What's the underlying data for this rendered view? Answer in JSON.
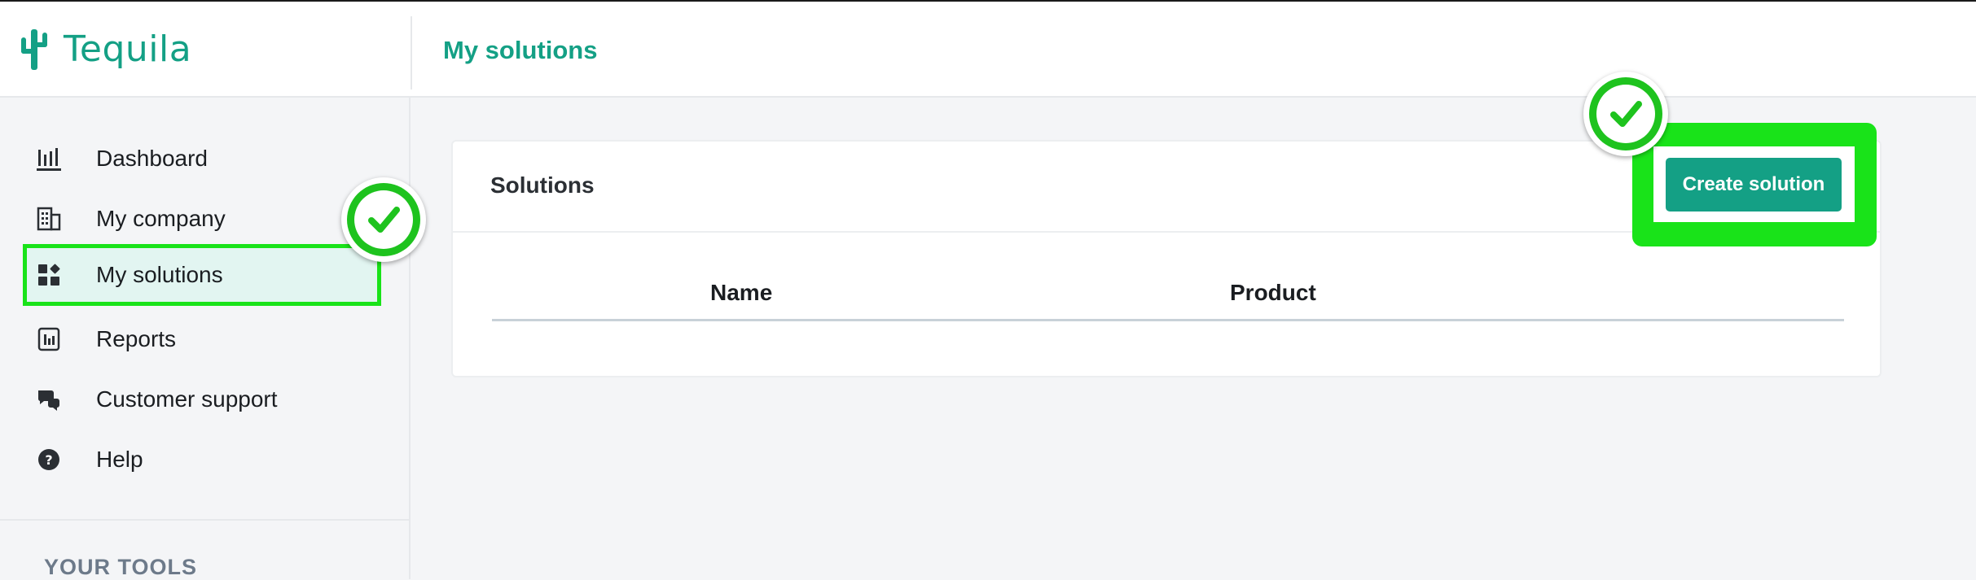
{
  "app": {
    "name": "Tequila",
    "brand_color": "#14a085"
  },
  "header": {
    "page_title": "My solutions"
  },
  "sidebar": {
    "items": [
      {
        "label": "Dashboard",
        "icon": "bar-chart-icon",
        "active": false
      },
      {
        "label": "My company",
        "icon": "building-icon",
        "active": false
      },
      {
        "label": "My solutions",
        "icon": "grid-icon",
        "active": true
      },
      {
        "label": "Reports",
        "icon": "report-icon",
        "active": false
      },
      {
        "label": "Customer support",
        "icon": "chat-icon",
        "active": false
      },
      {
        "label": "Help",
        "icon": "help-icon",
        "active": false
      }
    ],
    "section_title": "YOUR TOOLS"
  },
  "main": {
    "card_title": "Solutions",
    "create_button": "Create solution",
    "table": {
      "columns": [
        "Name",
        "Product"
      ],
      "rows": []
    }
  },
  "highlight_color": "#19e319"
}
